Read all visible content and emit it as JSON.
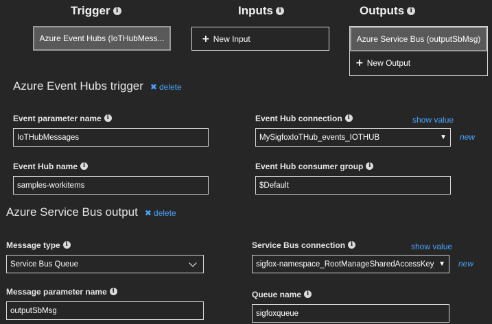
{
  "columns": {
    "trigger": "Trigger",
    "inputs": "Inputs",
    "outputs": "Outputs"
  },
  "trigger_button": "Azure Event Hubs (IoTHubMess...",
  "new_input_button": "New Input",
  "output_selected_button": "Azure Service Bus (outputSbMsg)",
  "new_output_button": "New Output",
  "trigger_section": {
    "title": "Azure Event Hubs trigger",
    "delete": "delete",
    "event_parameter_name": {
      "label": "Event parameter name",
      "value": "IoTHubMessages"
    },
    "event_hub_connection": {
      "label": "Event Hub connection",
      "value": "MySigfoxIoTHub_events_IOTHUB",
      "show_value": "show value",
      "new": "new"
    },
    "event_hub_name": {
      "label": "Event Hub name",
      "value": "samples-workitems"
    },
    "consumer_group": {
      "label": "Event Hub consumer group",
      "value": "$Default"
    }
  },
  "output_section": {
    "title": "Azure Service Bus output",
    "delete": "delete",
    "message_type": {
      "label": "Message type",
      "value": "Service Bus Queue"
    },
    "service_bus_connection": {
      "label": "Service Bus connection",
      "value": "sigfox-namespace_RootManageSharedAccessKey_S",
      "show_value": "show value",
      "new": "new"
    },
    "message_parameter_name": {
      "label": "Message parameter name",
      "value": "outputSbMsg"
    },
    "queue_name": {
      "label": "Queue name",
      "value": "sigfoxqueue"
    }
  },
  "icons": {
    "info": "i",
    "plus": "+",
    "delete": "✖",
    "dropdown": "▼"
  },
  "colors": {
    "background": "#262626",
    "link": "#4aa3ff",
    "selected_button": "#595959"
  }
}
